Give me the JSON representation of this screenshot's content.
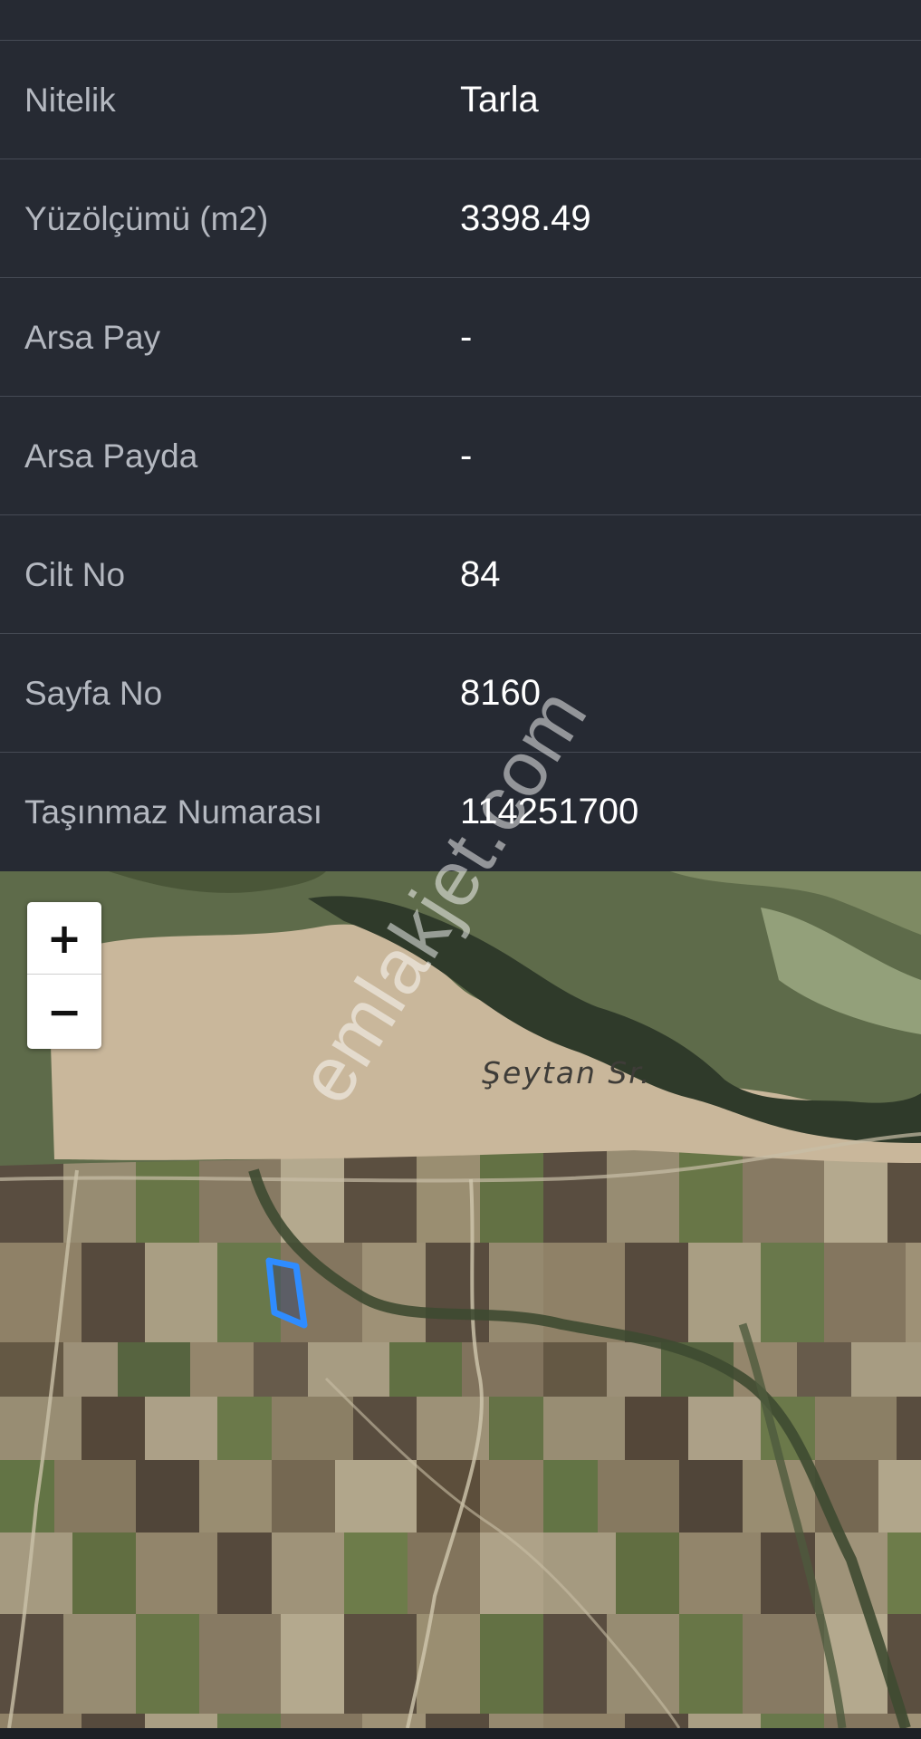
{
  "property_details": {
    "rows": [
      {
        "label": "Nitelik",
        "value": "Tarla"
      },
      {
        "label": "Yüzölçümü (m2)",
        "value": "3398.49"
      },
      {
        "label": "Arsa Pay",
        "value": "-"
      },
      {
        "label": "Arsa Payda",
        "value": "-"
      },
      {
        "label": "Cilt No",
        "value": "84"
      },
      {
        "label": "Sayfa No",
        "value": "8160"
      },
      {
        "label": "Taşınmaz Numarası",
        "value": "114251700"
      }
    ]
  },
  "map": {
    "zoom_in_label": "+",
    "zoom_out_label": "−",
    "place_label": "Şeytan Sr.",
    "parcel_outline_color": "#2f8cff",
    "watermark": "emlakjet.com"
  },
  "colors": {
    "background": "#262a33",
    "label_text": "#b4b8c0",
    "value_text": "#ffffff",
    "divider": "#464b55"
  }
}
